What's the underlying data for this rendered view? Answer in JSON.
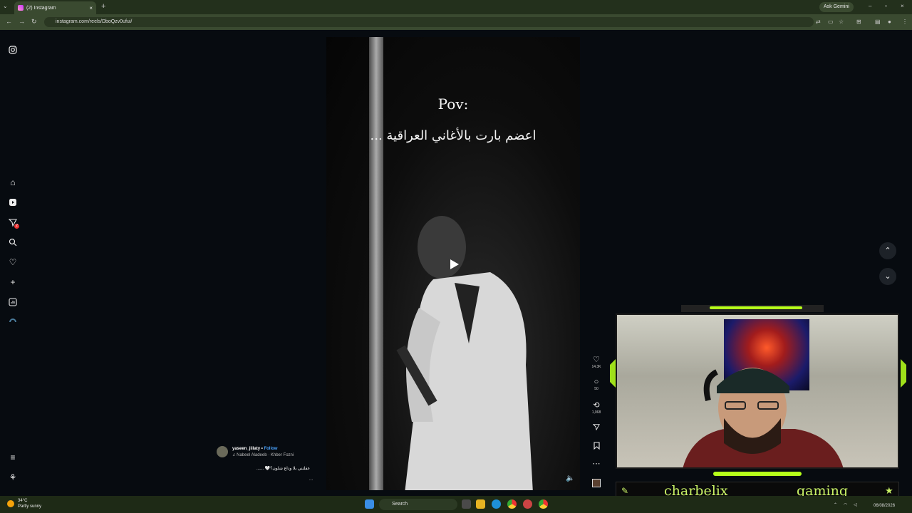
{
  "browser": {
    "tab_title": "(2) Instagram",
    "url": "instagram.com/reels/DboQzv0ufui/",
    "gemini_label": "Ask Gemini"
  },
  "reel": {
    "overlay_title": "Pov:",
    "overlay_arabic": "اعضم بارت بالأغاني العراقية ...",
    "username": "yaseen_jiilaty",
    "follow_label": "Follow",
    "audio": "Nabeel Aladeeb · Khber Fozni",
    "caption": "عقلتني بلا وداع شلون؟🤍 ......",
    "more": "...",
    "likes": "14.3K",
    "comments": "50",
    "reposts": "1,068"
  },
  "sidebar": {
    "notification_count": "2"
  },
  "overlay": {
    "name_left": "charbelix",
    "name_right": "gaming"
  },
  "taskbar": {
    "temperature": "34°C",
    "weather": "Partly sunny",
    "search_label": "Search",
    "date": "06/08/2026"
  },
  "colors": {
    "accent_lime": "#b6ff1a",
    "instagram_follow": "#4aa3ff",
    "notification_badge": "#e33333"
  }
}
